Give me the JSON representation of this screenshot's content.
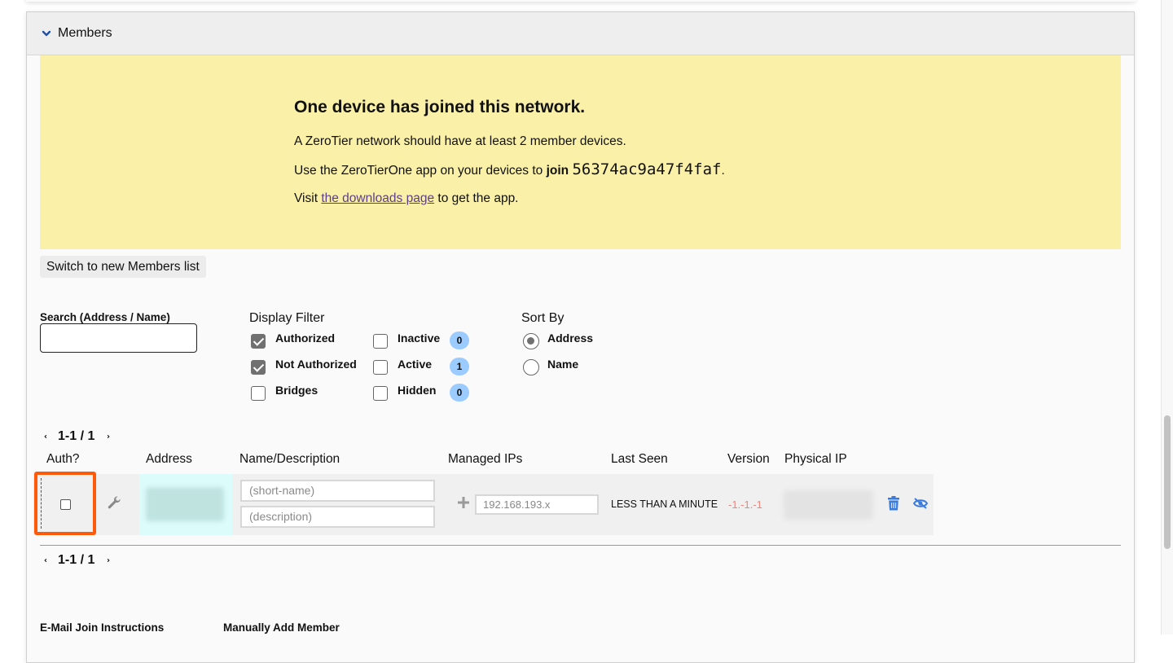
{
  "members_panel": {
    "title": "Members",
    "expanded": true
  },
  "notice": {
    "heading": "One device has joined this network.",
    "line1": "A ZeroTier network should have at least 2 member devices.",
    "line2_prefix": "Use the ZeroTierOne app on your devices to ",
    "line2_bold": "join",
    "network_id": "56374ac9a47f4faf",
    "line2_suffix": ".",
    "line3_prefix": "Visit ",
    "line3_link": "the downloads page",
    "line3_suffix": " to get the app.",
    "bg_color": "#faf0a8"
  },
  "switch_button_label": "Switch to new Members list",
  "search": {
    "label": "Search (Address / Name)",
    "value": "",
    "placeholder": ""
  },
  "display_filter": {
    "title": "Display Filter",
    "options": [
      {
        "label": "Authorized",
        "checked": true
      },
      {
        "label": "Not Authorized",
        "checked": true
      },
      {
        "label": "Bridges",
        "checked": false
      },
      {
        "label": "Inactive",
        "checked": false,
        "count": "0"
      },
      {
        "label": "Active",
        "checked": false,
        "count": "1"
      },
      {
        "label": "Hidden",
        "checked": false,
        "count": "0"
      }
    ]
  },
  "sort_by": {
    "title": "Sort By",
    "options": [
      {
        "label": "Address",
        "selected": true
      },
      {
        "label": "Name",
        "selected": false
      }
    ]
  },
  "pagination": {
    "range": "1-1",
    "sep": "/",
    "total": "1",
    "prev_icon": "chevron-left-icon",
    "next_icon": "chevron-right-icon"
  },
  "table": {
    "headers": [
      "Auth?",
      "Address",
      "Name/Description",
      "Managed IPs",
      "Last Seen",
      "Version",
      "Physical IP"
    ],
    "rows": [
      {
        "authorized": false,
        "address": "(blurred)",
        "short_name_placeholder": "(short-name)",
        "description_placeholder": "(description)",
        "managed_ip_placeholder": "192.168.193.x",
        "last_seen": "LESS THAN A MINUTE",
        "version": "-1.-1.-1",
        "physical_ip": "(blurred)",
        "icons": [
          "wrench-icon",
          "plus-icon",
          "trash-icon",
          "eye-slash-icon"
        ]
      }
    ]
  },
  "bottom": {
    "email_label": "E-Mail Join Instructions",
    "manual_add_label": "Manually Add Member"
  },
  "colors": {
    "highlight": "#ff5a0a",
    "badge": "#9ccbff",
    "icon_blue": "#3a7be0",
    "version_red": "#e8877e"
  }
}
